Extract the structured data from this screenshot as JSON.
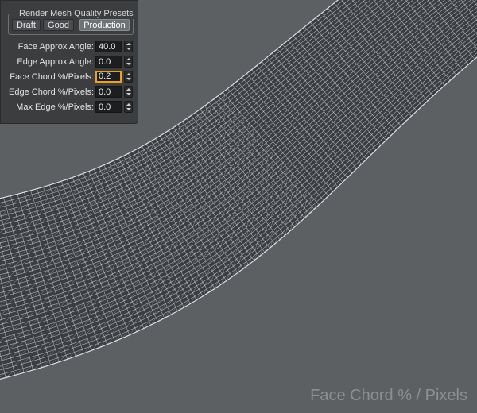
{
  "panel": {
    "presets_title": "Render Mesh Quality Presets",
    "presets": [
      {
        "label": "Draft",
        "active": false
      },
      {
        "label": "Good",
        "active": false
      },
      {
        "label": "Production",
        "active": true
      }
    ],
    "rows": [
      {
        "label": "Face Approx Angle:",
        "value": "40.0",
        "focused": false
      },
      {
        "label": "Edge Approx Angle:",
        "value": "0.0",
        "focused": false
      },
      {
        "label": "Face Chord %/Pixels:",
        "value": "0.2",
        "focused": true
      },
      {
        "label": "Edge Chord %/Pixels:",
        "value": "0.0",
        "focused": false
      },
      {
        "label": "Max Edge %/Pixels:",
        "value": "0.0",
        "focused": false
      }
    ]
  },
  "caption": "Face Chord % / Pixels",
  "colors": {
    "background": "#5d6063",
    "mesh_fill": "#3a3d41",
    "mesh_lines": "#dcdfe2",
    "focus_outline": "#f0a020"
  }
}
